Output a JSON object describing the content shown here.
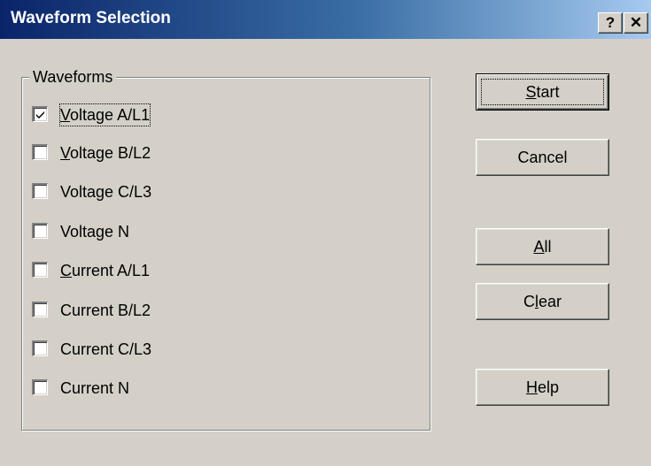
{
  "window": {
    "title": "Waveform Selection",
    "help_caption": "?",
    "close_caption": "✕"
  },
  "group": {
    "label": "Waveforms"
  },
  "checkboxes": [
    {
      "label": "Voltage A/L1",
      "access_key": "V",
      "rest": "oltage A/L1",
      "checked": true
    },
    {
      "label": "Voltage B/L2",
      "access_key": "V",
      "rest": "oltage B/L2",
      "checked": false
    },
    {
      "label": "Voltage C/L3",
      "access_key": "",
      "rest": "Voltage C/L3",
      "checked": false
    },
    {
      "label": "Voltage N",
      "access_key": "",
      "rest": "Voltage N",
      "checked": false
    },
    {
      "label": "Current A/L1",
      "access_key": "C",
      "rest": "urrent A/L1",
      "checked": false
    },
    {
      "label": "Current B/L2",
      "access_key": "",
      "rest": "Current B/L2",
      "checked": false
    },
    {
      "label": "Current C/L3",
      "access_key": "",
      "rest": "Current C/L3",
      "checked": false
    },
    {
      "label": "Current N",
      "access_key": "",
      "rest": "Current N",
      "checked": false
    }
  ],
  "buttons": {
    "start": {
      "pre": "",
      "key": "S",
      "post": "tart"
    },
    "cancel": {
      "label": "Cancel"
    },
    "all": {
      "pre": "",
      "key": "A",
      "post": "ll"
    },
    "clear": {
      "pre": "C",
      "key": "l",
      "post": "ear"
    },
    "help": {
      "pre": "",
      "key": "H",
      "post": "elp"
    }
  },
  "colors": {
    "titlebar_start": "#0a246a",
    "titlebar_end": "#a6caf0",
    "face": "#d4d0c8"
  }
}
